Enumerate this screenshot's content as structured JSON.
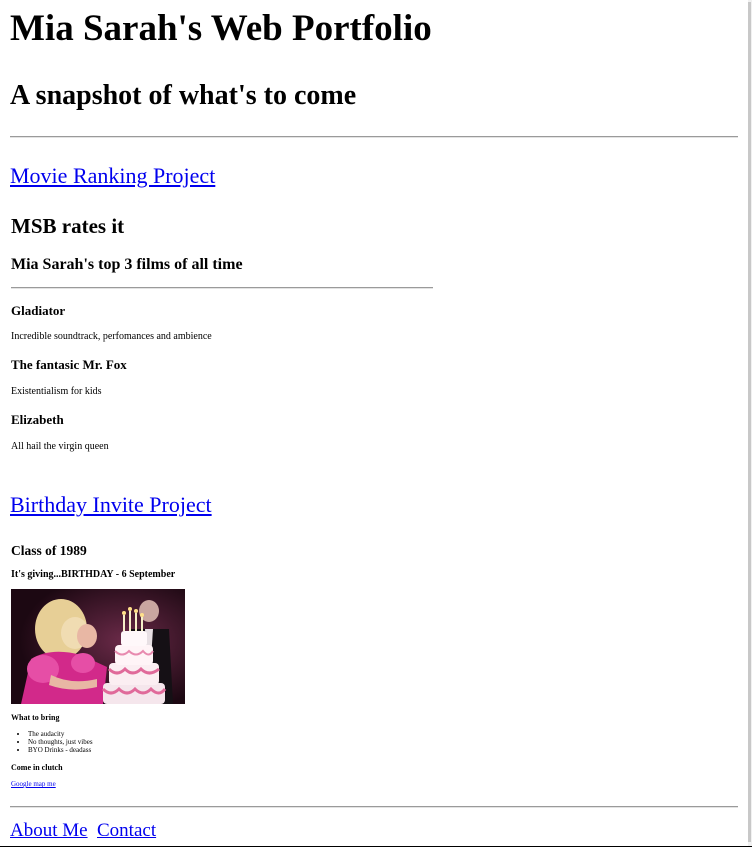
{
  "header": {
    "title": "Mia Sarah's Web Portfolio",
    "subtitle": "A snapshot of what's to come"
  },
  "movie_section": {
    "link_text": "Movie Ranking Project",
    "heading": "MSB rates it",
    "subheading": "Mia Sarah's top 3 films of all time",
    "films": [
      {
        "title": "Gladiator",
        "description": "Incredible soundtrack, perfomances and ambience"
      },
      {
        "title": "The fantasic Mr. Fox",
        "description": "Existentialism for kids"
      },
      {
        "title": "Elizabeth",
        "description": "All hail the virgin queen"
      }
    ]
  },
  "birthday_section": {
    "link_text": "Birthday Invite Project",
    "heading": "Class of 1989",
    "subheading": "It's giving...BIRTHDAY - 6 September",
    "bring_heading": "What to bring",
    "bring_items": [
      "The audacity",
      "No thoughts, just vibes",
      "BYO Drinks - deadass"
    ],
    "clutch_heading": "Come in clutch",
    "map_link": "Google map me"
  },
  "footer": {
    "about_link": "About Me",
    "contact_link": "Contact"
  }
}
